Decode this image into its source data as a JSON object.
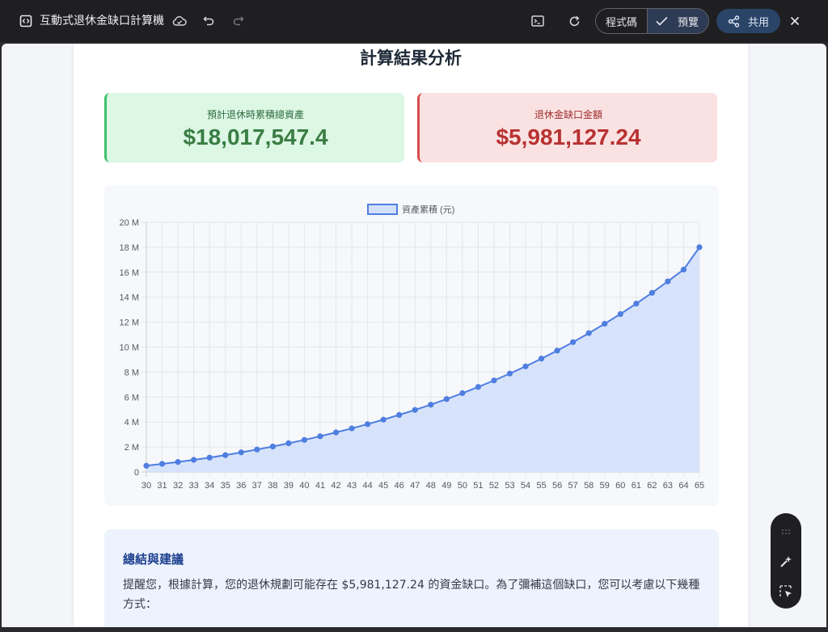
{
  "window": {
    "title": "互動式退休金缺口計算機",
    "code_label": "程式碼",
    "preview_label": "預覽",
    "share_label": "共用"
  },
  "page": {
    "heading": "計算結果分析",
    "total_assets": {
      "label": "預計退休時累積總資產",
      "value": "$18,017,547.4"
    },
    "gap": {
      "label": "退休金缺口金額",
      "value": "$5,981,127.24"
    },
    "summary": {
      "title": "總結與建議",
      "text": "提醒您，根據計算，您的退休規劃可能存在 $5,981,127.24 的資金缺口。為了彌補這個缺口，您可以考慮以下幾種方式："
    }
  },
  "colors": {
    "line": "#4f7ee0",
    "fill": "#d3e0f9",
    "accent_green": "#3a7d44",
    "accent_red": "#b83232"
  },
  "chart_data": {
    "type": "area",
    "legend": "資產累積 (元)",
    "legend_position": "top",
    "grid": true,
    "x": [
      30,
      31,
      32,
      33,
      34,
      35,
      36,
      37,
      38,
      39,
      40,
      41,
      42,
      43,
      44,
      45,
      46,
      47,
      48,
      49,
      50,
      51,
      52,
      53,
      54,
      55,
      56,
      57,
      58,
      59,
      60,
      61,
      62,
      63,
      64,
      65
    ],
    "y": [
      0.5,
      0.65,
      0.8,
      0.97,
      1.15,
      1.35,
      1.57,
      1.8,
      2.04,
      2.3,
      2.57,
      2.86,
      3.17,
      3.49,
      3.83,
      4.19,
      4.57,
      4.97,
      5.39,
      5.84,
      6.31,
      6.81,
      7.33,
      7.88,
      8.46,
      9.08,
      9.72,
      10.4,
      11.12,
      11.87,
      12.65,
      13.48,
      14.35,
      15.26,
      16.21,
      18.0
    ],
    "y_unit": "M",
    "ylim": [
      0,
      20
    ],
    "y_ticks": [
      "0",
      "2 M",
      "4 M",
      "6 M",
      "8 M",
      "10 M",
      "12 M",
      "14 M",
      "16 M",
      "18 M",
      "20 M"
    ]
  }
}
